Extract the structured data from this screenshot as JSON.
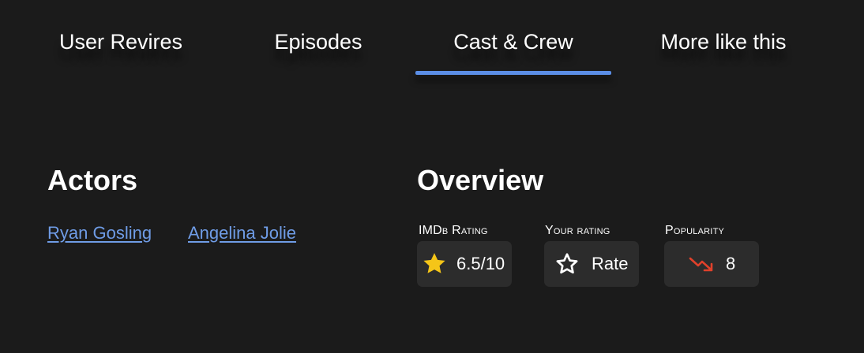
{
  "tabs": [
    {
      "label": "User Revires",
      "active": false
    },
    {
      "label": "Episodes",
      "active": false
    },
    {
      "label": "Cast & Crew",
      "active": true
    },
    {
      "label": "More like this",
      "active": false
    }
  ],
  "actors": {
    "title": "Actors",
    "names": [
      "Ryan Gosling",
      "Angelina Jolie"
    ]
  },
  "overview": {
    "title": "Overview",
    "imdb_rating": {
      "label": "IMDb Rating",
      "value": "6.5/10",
      "icon": "star-filled-icon"
    },
    "your_rating": {
      "label": "Your rating",
      "value": "Rate",
      "icon": "star-outline-icon"
    },
    "popularity": {
      "label": "Popularity",
      "value": "8",
      "icon": "trend-down-icon"
    }
  },
  "colors": {
    "background": "#1b1b1b",
    "accent": "#5b8ee6",
    "link": "#6f9ce6",
    "star": "#f5c518",
    "trend_down": "#e0412b",
    "box": "#2c2c2c"
  }
}
